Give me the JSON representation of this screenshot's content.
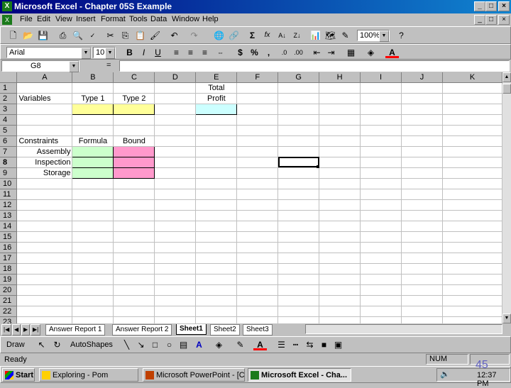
{
  "window": {
    "title": "Microsoft Excel - Chapter 05S Example"
  },
  "menu": [
    "File",
    "Edit",
    "View",
    "Insert",
    "Format",
    "Tools",
    "Data",
    "Window",
    "Help"
  ],
  "toolbar": {
    "zoom": "100%"
  },
  "format_bar": {
    "font": "Arial",
    "size": "10"
  },
  "formula_bar": {
    "name_box": "G8",
    "equals": "="
  },
  "columns": [
    "A",
    "B",
    "C",
    "D",
    "E",
    "F",
    "G",
    "H",
    "I",
    "J",
    "K"
  ],
  "rows": [
    "1",
    "2",
    "3",
    "4",
    "5",
    "6",
    "7",
    "8",
    "9",
    "10",
    "11",
    "12",
    "13",
    "14",
    "15",
    "16",
    "17",
    "18",
    "19",
    "20",
    "21",
    "22",
    "23"
  ],
  "cells": {
    "E1": "Total",
    "A2": "Variables",
    "B2": "Type 1",
    "C2": "Type 2",
    "E2": "Profit",
    "A6": "Constraints",
    "B6": "Formula",
    "C6": "Bound",
    "A7": "Assembly",
    "A8": "Inspection",
    "A9": "Storage"
  },
  "sheet_tabs": [
    "Answer Report 1",
    "Answer Report 2",
    "Sheet1",
    "Sheet2",
    "Sheet3"
  ],
  "active_sheet": "Sheet1",
  "draw_bar": {
    "draw": "Draw",
    "autoshapes": "AutoShapes"
  },
  "status": {
    "left": "Ready",
    "num": "NUM"
  },
  "taskbar": {
    "start": "Start",
    "tasks": [
      "Exploring - Pom",
      "Microsoft PowerPoint - [Ch...",
      "Microsoft Excel - Cha..."
    ],
    "clock": "12:37 PM"
  },
  "slide_number": "45",
  "colors": {
    "title": "#000080",
    "yellow": "#ffff99",
    "cyan": "#ccffff",
    "green": "#ccffcc",
    "pink": "#ff99cc"
  }
}
